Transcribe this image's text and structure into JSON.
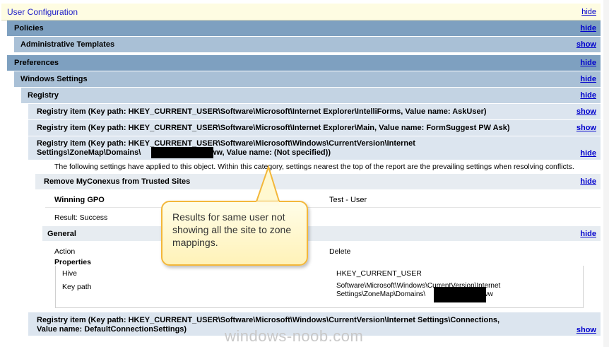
{
  "user_config": {
    "title": "User Configuration",
    "toggle": "hide"
  },
  "policies": {
    "title": "Policies",
    "toggle": "hide"
  },
  "admin_templates": {
    "title": "Administrative Templates",
    "toggle": "show"
  },
  "preferences": {
    "title": "Preferences",
    "toggle": "hide"
  },
  "windows_settings": {
    "title": "Windows Settings",
    "toggle": "hide"
  },
  "registry": {
    "title": "Registry",
    "toggle": "hide"
  },
  "registry_items": [
    {
      "text": "Registry item (Key path: HKEY_CURRENT_USER\\Software\\Microsoft\\Internet Explorer\\IntelliForms, Value name: AskUser)",
      "toggle": "show"
    },
    {
      "text": "Registry item (Key path: HKEY_CURRENT_USER\\Software\\Microsoft\\Internet Explorer\\Main, Value name: FormSuggest PW Ask)",
      "toggle": "show"
    },
    {
      "line1": "Registry item (Key path: HKEY_CURRENT_USER\\Software\\Microsoft\\Windows\\CurrentVersion\\Internet",
      "line2_prefix": "Settings\\ZoneMap\\Domains\\",
      "line2_suffix": "www, Value name: (Not specified))",
      "toggle": "hide"
    },
    {
      "line1": "Registry item (Key path: HKEY_CURRENT_USER\\Software\\Microsoft\\Windows\\CurrentVersion\\Internet Settings\\Connections,",
      "line2": "Value name: DefaultConnectionSettings)",
      "toggle": "show"
    }
  ],
  "note": "The following settings have applied to this object. Within this category, settings nearest the top of the report are the prevailing settings when resolving conflicts.",
  "remove_section": {
    "title": "Remove MyConexus from Trusted Sites",
    "toggle": "hide"
  },
  "winning_gpo": {
    "label": "Winning GPO",
    "value": "Test - User"
  },
  "result": "Result: Success",
  "general": {
    "title": "General",
    "toggle": "hide"
  },
  "action": {
    "label": "Action",
    "value": "Delete"
  },
  "properties": {
    "title": "Properties",
    "hive_label": "Hive",
    "hive_value": "HKEY_CURRENT_USER",
    "keypath_label": "Key path",
    "keypath_line1": "Software\\Microsoft\\Windows\\CurrentVersion\\Internet",
    "keypath_line2_prefix": "Settings\\ZoneMap\\Domains\\",
    "keypath_line2_suffix": "www"
  },
  "callout": {
    "text": "Results for same user not showing all the site to zone mappings."
  },
  "watermark": "windows-noob.com"
}
